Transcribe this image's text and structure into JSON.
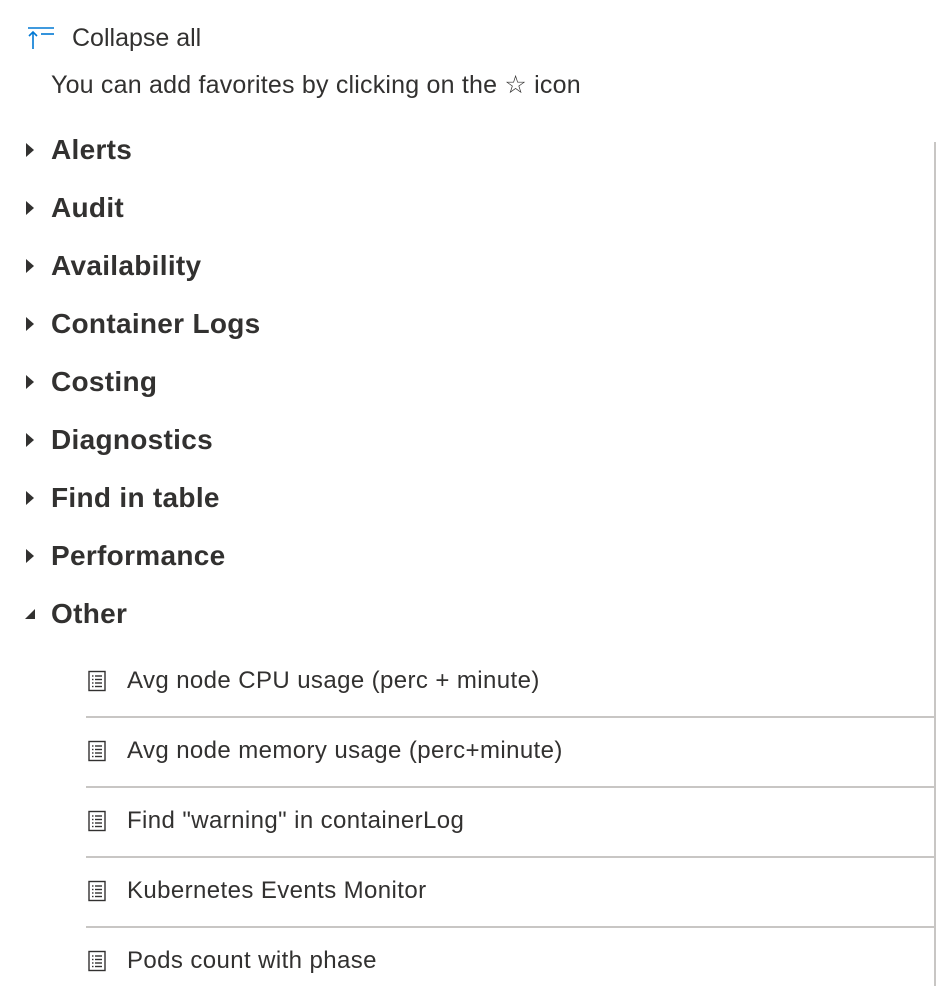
{
  "toolbar": {
    "collapse_all_label": "Collapse all",
    "collapse_all_icon": "collapse-all-icon"
  },
  "hint": {
    "text": "You can add favorites by clicking on the ☆ icon"
  },
  "groups": [
    {
      "label": "Alerts",
      "expanded": false
    },
    {
      "label": "Audit",
      "expanded": false
    },
    {
      "label": "Availability",
      "expanded": false
    },
    {
      "label": "Container Logs",
      "expanded": false
    },
    {
      "label": "Costing",
      "expanded": false
    },
    {
      "label": "Diagnostics",
      "expanded": false
    },
    {
      "label": "Find in table",
      "expanded": false
    },
    {
      "label": "Performance",
      "expanded": false
    },
    {
      "label": "Other",
      "expanded": true
    }
  ],
  "other_queries": [
    {
      "label": "Avg node CPU usage (perc + minute)",
      "icon": "document-list-icon"
    },
    {
      "label": "Avg node memory usage (perc+minute)",
      "icon": "document-list-icon"
    },
    {
      "label": "Find \"warning\" in containerLog",
      "icon": "document-list-icon"
    },
    {
      "label": "Kubernetes Events Monitor",
      "icon": "document-list-icon"
    },
    {
      "label": "Pods count with phase",
      "icon": "document-list-icon"
    }
  ],
  "colors": {
    "accent": "#0078d4",
    "text": "#323130",
    "divider": "#c8c6c4"
  }
}
